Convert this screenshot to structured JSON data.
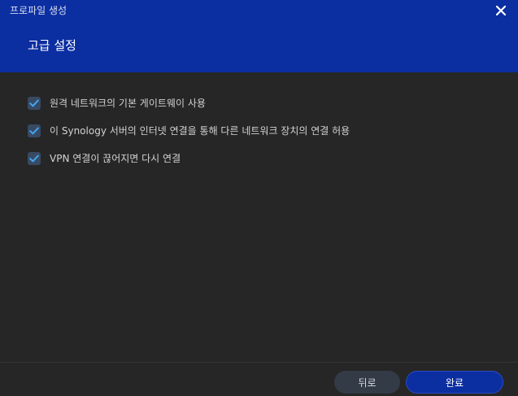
{
  "window": {
    "title": "프로파일 생성",
    "close_icon": "close-icon"
  },
  "header": {
    "section_title": "고급 설정",
    "background_color": "#0b2ea1"
  },
  "options": [
    {
      "label": "원격 네트워크의 기본 게이트웨이 사용",
      "checked": true
    },
    {
      "label": "이 Synology 서버의 인터넷 연결을 통해 다른 네트워크 장치의 연결 허용",
      "checked": true
    },
    {
      "label": "VPN 연결이 끊어지면 다시 연결",
      "checked": true
    }
  ],
  "footer": {
    "back_label": "뒤로",
    "done_label": "완료"
  },
  "colors": {
    "accent": "#0b2ea1",
    "check": "#3fa9f5",
    "background": "#262626"
  }
}
